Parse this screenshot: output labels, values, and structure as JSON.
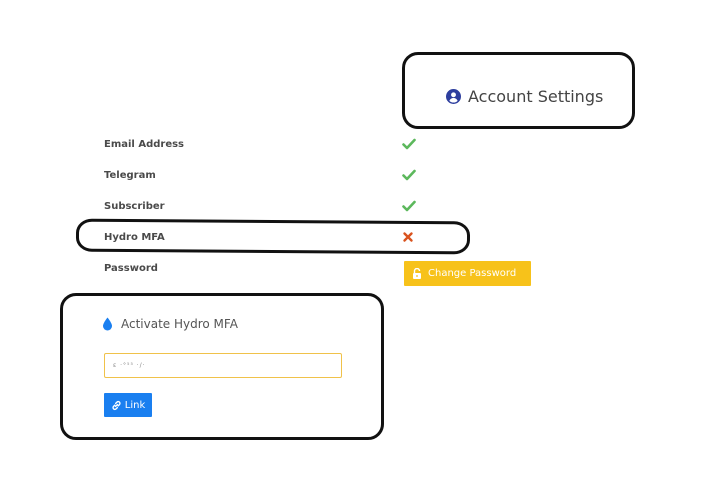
{
  "header": {
    "title": "Account Settings",
    "icon": "user-circle-icon",
    "icon_color": "#2d3e9e"
  },
  "status_rows": [
    {
      "label": "Email Address",
      "status": "verified",
      "icon": "check-icon"
    },
    {
      "label": "Telegram",
      "status": "verified",
      "icon": "check-icon"
    },
    {
      "label": "Subscriber",
      "status": "verified",
      "icon": "check-icon"
    },
    {
      "label": "Hydro MFA",
      "status": "not-verified",
      "icon": "x-icon"
    },
    {
      "label": "Password",
      "status": "action",
      "icon": ""
    }
  ],
  "change_password": {
    "label": "Change Password",
    "icon": "unlock-icon",
    "color": "#f7c21a"
  },
  "activate_mfa": {
    "title": "Activate Hydro MFA",
    "icon": "droplet-icon",
    "input_value": "ɛ ·°⁵⁵ ·/·",
    "input_border_color": "#f0c24a",
    "link_label": "Link",
    "link_icon": "link-icon",
    "link_color": "#1a7ff0"
  },
  "colors": {
    "check": "#5cb85c",
    "cross": "#d9531e",
    "annotation": "#111111"
  }
}
